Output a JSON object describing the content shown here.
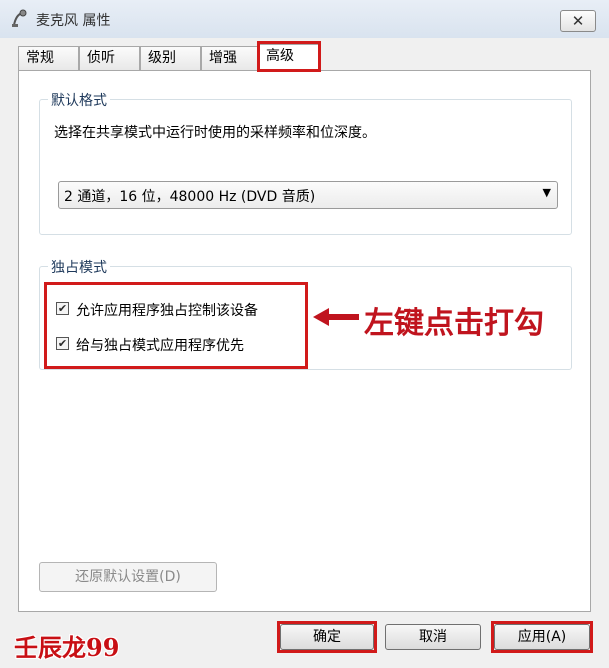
{
  "window": {
    "title": "麦克风 属性",
    "close_label": "✕"
  },
  "tabs": [
    {
      "label": "常规"
    },
    {
      "label": "侦听"
    },
    {
      "label": "级别"
    },
    {
      "label": "增强"
    },
    {
      "label": "高级",
      "active": true
    }
  ],
  "default_format": {
    "title": "默认格式",
    "description": "选择在共享模式中运行时使用的采样频率和位深度。",
    "selected": "2 通道，16 位，48000 Hz (DVD 音质)"
  },
  "exclusive_mode": {
    "title": "独占模式",
    "options": [
      {
        "label": "允许应用程序独占控制该设备",
        "checked": true
      },
      {
        "label": "给与独占模式应用程序优先",
        "checked": true
      }
    ]
  },
  "restore_label": "还原默认设置(D)",
  "buttons": {
    "ok": "确定",
    "cancel": "取消",
    "apply": "应用(A)"
  },
  "annotation": "左键点击打勾",
  "watermark": "壬辰龙99",
  "colors": {
    "highlight": "#d11a1a",
    "annotation": "#c0141e"
  }
}
